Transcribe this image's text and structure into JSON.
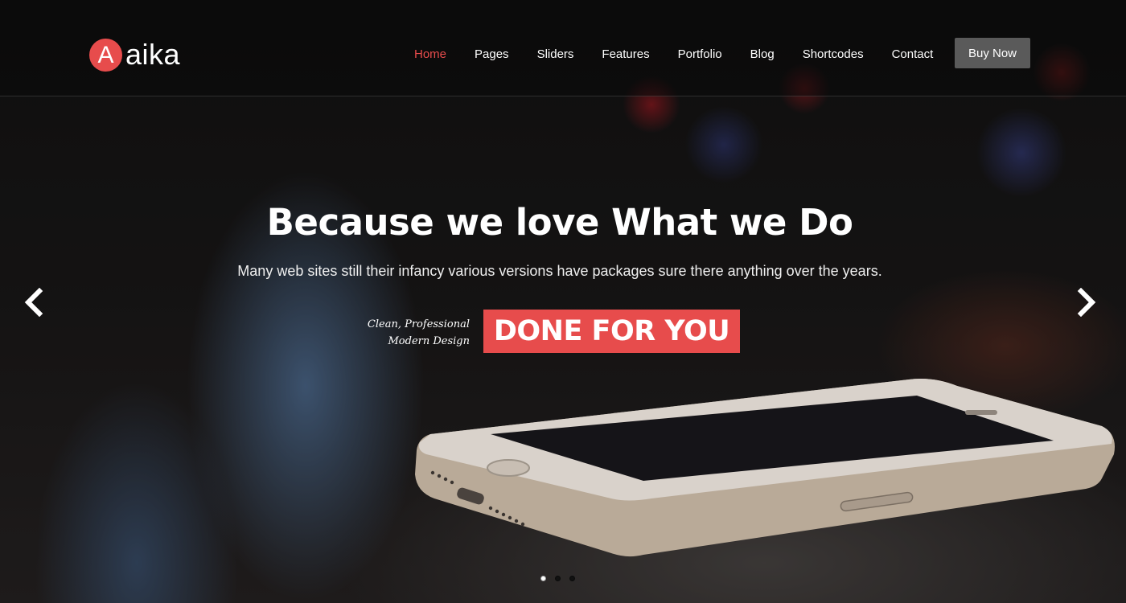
{
  "brand": {
    "logo_letter": "A",
    "logo_text": "aika",
    "accent_color": "#e74c4c"
  },
  "nav": {
    "items": [
      {
        "label": "Home",
        "active": true
      },
      {
        "label": "Pages"
      },
      {
        "label": "Sliders"
      },
      {
        "label": "Features"
      },
      {
        "label": "Portfolio"
      },
      {
        "label": "Blog"
      },
      {
        "label": "Shortcodes"
      },
      {
        "label": "Contact"
      }
    ],
    "buy_button": "Buy Now"
  },
  "slide": {
    "title": "Because we love What we Do",
    "subtitle": "Many web sites still their infancy various versions have packages sure there anything over the years.",
    "tagline_line1": "Clean, Professional",
    "tagline_line2": "Modern Design",
    "badge": "DONE FOR YOU"
  },
  "slider": {
    "prev_icon": "chevron-left-icon",
    "next_icon": "chevron-right-icon",
    "dot_count": 3,
    "active_dot": 1
  }
}
